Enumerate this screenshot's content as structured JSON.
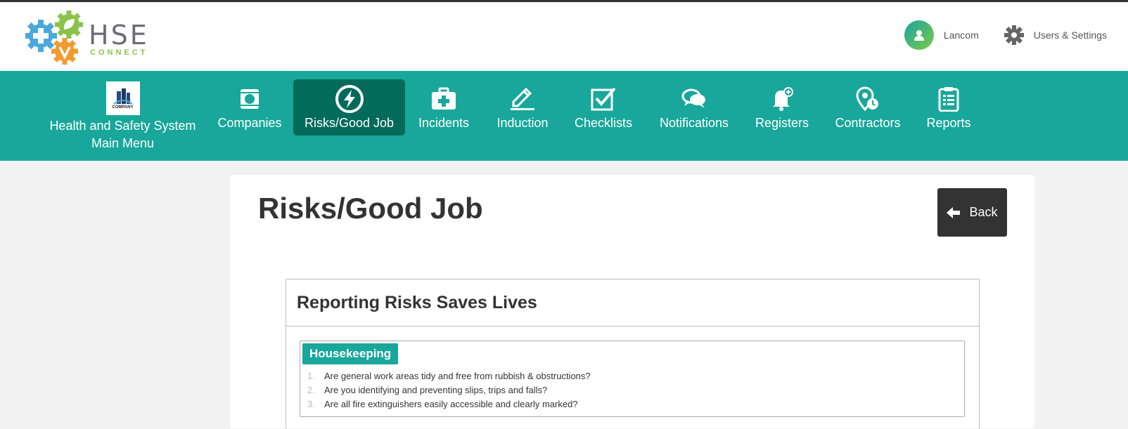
{
  "brand": {
    "name": "HSE",
    "subtitle": "CONNECT"
  },
  "header": {
    "user_name": "Lancom",
    "settings_label": "Users & Settings"
  },
  "nav": {
    "items": [
      {
        "label": "Health and Safety System Main Menu",
        "icon": "company-logo"
      },
      {
        "label": "Companies",
        "icon": "building-icon"
      },
      {
        "label": "Risks/Good Job",
        "icon": "lightning-icon",
        "active": true
      },
      {
        "label": "Incidents",
        "icon": "first-aid-icon"
      },
      {
        "label": "Induction",
        "icon": "pencil-icon"
      },
      {
        "label": "Checklists",
        "icon": "checkbox-icon"
      },
      {
        "label": "Notifications",
        "icon": "chat-icon"
      },
      {
        "label": "Registers",
        "icon": "bell-icon"
      },
      {
        "label": "Contractors",
        "icon": "location-clock-icon"
      },
      {
        "label": "Reports",
        "icon": "clipboard-icon"
      }
    ],
    "company_logo_text": "COMPANY"
  },
  "main": {
    "title": "Risks/Good Job",
    "back_label": "Back",
    "panel_title": "Reporting Risks Saves Lives",
    "section": {
      "tag": "Housekeeping",
      "questions": [
        {
          "num": "1.",
          "text": "Are general work areas tidy and free from rubbish & obstructions?"
        },
        {
          "num": "2.",
          "text": "Are you identifying and preventing slips, trips and falls?"
        },
        {
          "num": "3.",
          "text": "Are all fire extinguishers easily accessible and clearly marked?"
        }
      ]
    }
  },
  "colors": {
    "nav_bg": "#18a79a",
    "nav_active": "#046b5b",
    "tag_bg": "#18a79a",
    "back_bg": "#333333"
  }
}
